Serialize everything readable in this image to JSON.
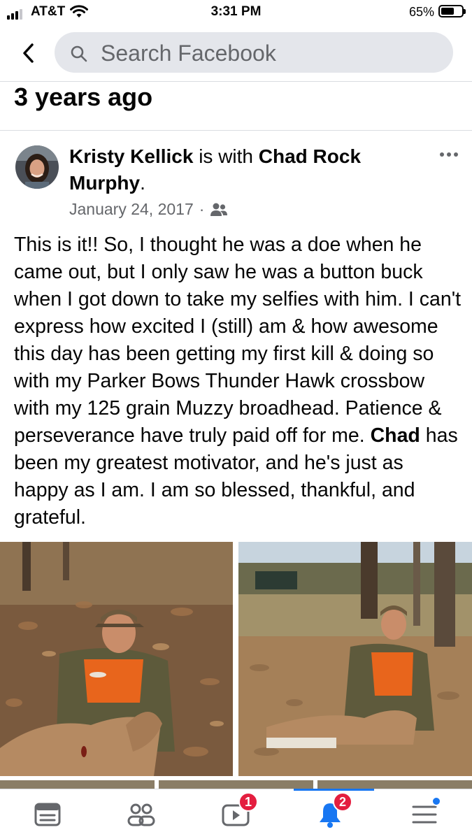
{
  "status_bar": {
    "carrier": "AT&T",
    "time": "3:31 PM",
    "battery_percent": "65%",
    "battery_level": 0.65
  },
  "header": {
    "search_placeholder": "Search Facebook"
  },
  "section": {
    "title": "3 years ago"
  },
  "post": {
    "author": "Kristy Kellick",
    "with_text": " is with ",
    "tagged": "Chad Rock Murphy",
    "tagged_end": ".",
    "date": "January 24, 2017",
    "meta_separator": "·",
    "audience_icon": "friends-icon",
    "body_part1": "This is it!! So, I thought he was a doe when he came out, but I only saw he was a button buck when I got down to take my selfies with him. I can't express how excited I (still) am & how awesome this day has been getting my first kill & doing so with my Parker Bows Thunder Hawk crossbow with my 125 grain Muzzy broadhead. Patience & perseverance have truly paid off for me. ",
    "body_mention": "Chad",
    "body_part2": " has been my greatest motivator, and he's just as happy as I am. I am so blessed, thankful, and grateful."
  },
  "tabs": {
    "news_feed_icon": "news-feed-icon",
    "friends_icon": "friends-icon",
    "watch_icon": "watch-icon",
    "watch_badge": "1",
    "notifications_icon": "bell-icon",
    "notifications_badge": "2",
    "menu_icon": "menu-icon"
  },
  "colors": {
    "accent": "#1877f2",
    "badge": "#e41e3f",
    "secondary_text": "#65676b"
  }
}
